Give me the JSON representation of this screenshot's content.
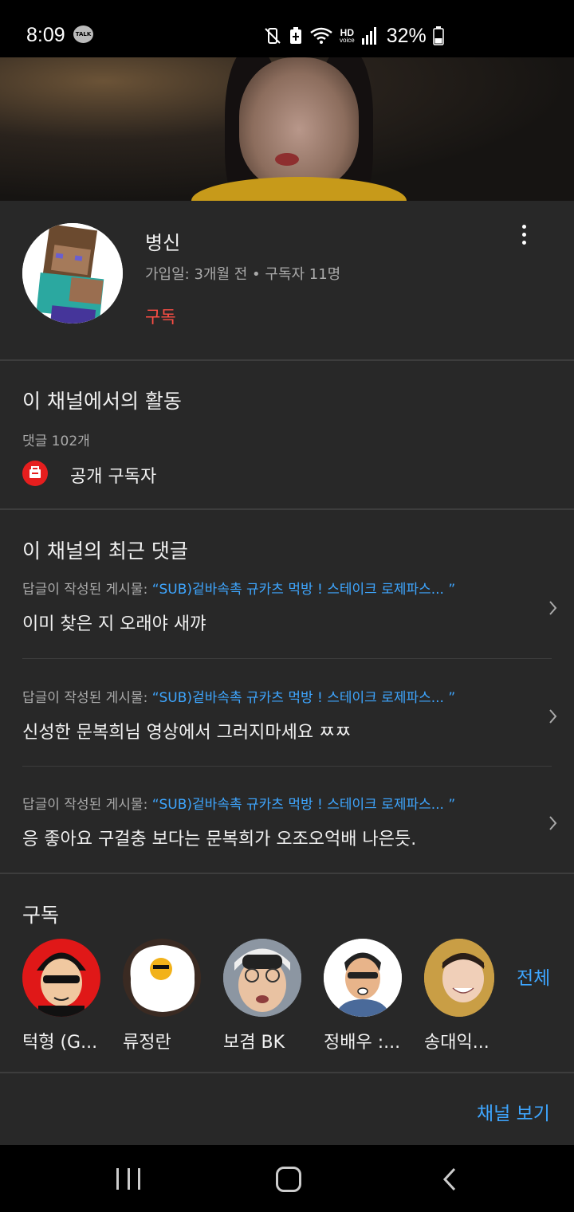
{
  "status_bar": {
    "time": "8:09",
    "talk_badge": "TALK",
    "hd_label": "HD",
    "voice_label": "voice",
    "battery": "32%",
    "icons": [
      "mute-vibrate-icon",
      "battery-saver-icon",
      "wifi-icon",
      "hd-voice-icon",
      "signal-icon",
      "battery-icon"
    ]
  },
  "channel": {
    "name": "병신",
    "meta": "가입일: 3개월 전 • 구독자 11명",
    "subscribe_label": "구독"
  },
  "activity": {
    "title": "이 채널에서의 활동",
    "comment_count": "댓글 102개",
    "public_subscriber": "공개 구독자"
  },
  "recent_comments": {
    "title": "이 채널의 최근 댓글",
    "items": [
      {
        "prefix": "답글이 작성된 게시물: ",
        "video": "“SUB)겉바속촉 규카츠 먹방 ! 스테이크 로제파스... ”",
        "text": "이미 찾은 지 오래야 새꺄"
      },
      {
        "prefix": "답글이 작성된 게시물: ",
        "video": "“SUB)겉바속촉 규카츠 먹방 ! 스테이크 로제파스... ”",
        "text": "신성한 문복희님 영상에서 그러지마세요 ㅉㅉ"
      },
      {
        "prefix": "답글이 작성된 게시물: ",
        "video": "“SUB)겉바속촉 규카츠 먹방 ! 스테이크 로제파스... ”",
        "text": "응 좋아요 구걸충 보다는 문복희가 오조오억배 나은듯."
      }
    ]
  },
  "subscriptions": {
    "title": "구독",
    "all_label": "전체",
    "items": [
      {
        "name": "턱형 (G..."
      },
      {
        "name": "류정란"
      },
      {
        "name": "보겸 BK"
      },
      {
        "name": "정배우 :..."
      },
      {
        "name": "송대익..."
      }
    ]
  },
  "view_channel_label": "채널 보기",
  "colors": {
    "background": "#282828",
    "accent_red": "#ff4e45",
    "link_blue": "#3ea6ff",
    "muted_text": "#aaaaaa"
  }
}
